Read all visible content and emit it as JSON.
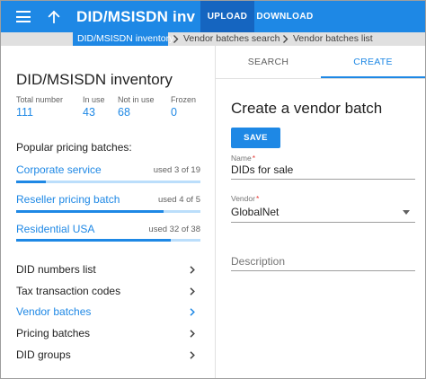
{
  "toolbar": {
    "menu_icon": "menu-icon",
    "back_icon": "arrow-up-icon",
    "title": "DID/MSISDN inventory",
    "upload_label": "UPLOAD",
    "download_label": "DOWNLOAD"
  },
  "breadcrumb": {
    "items": [
      "DID/MSISDN inventory",
      "Vendor batches search",
      "Vendor batches list"
    ]
  },
  "inventory": {
    "title": "DID/MSISDN inventory",
    "stats": [
      {
        "label": "Total number",
        "value": "111"
      },
      {
        "label": "In use",
        "value": "43"
      },
      {
        "label": "Not in use",
        "value": "68"
      },
      {
        "label": "Frozen",
        "value": "0"
      }
    ],
    "popular_label": "Popular pricing batches:",
    "batches": [
      {
        "name": "Corporate service",
        "used": "used 3 of 19",
        "fill_fraction": 0.16
      },
      {
        "name": "Reseller pricing batch",
        "used": "used 4 of 5",
        "fill_fraction": 0.8
      },
      {
        "name": "Residential USA",
        "used": "used 32 of 38",
        "fill_fraction": 0.84
      }
    ],
    "nav": [
      {
        "label": "DID numbers list",
        "active": false
      },
      {
        "label": "Tax transaction codes",
        "active": false
      },
      {
        "label": "Vendor batches",
        "active": true
      },
      {
        "label": "Pricing batches",
        "active": false
      },
      {
        "label": "DID groups",
        "active": false
      }
    ]
  },
  "tabs": {
    "search": "SEARCH",
    "create": "CREATE",
    "active": "create"
  },
  "form": {
    "title": "Create a vendor batch",
    "save_label": "SAVE",
    "name_label": "Name",
    "name_value": "DIDs for sale",
    "vendor_label": "Vendor",
    "vendor_value": "GlobalNet",
    "description_placeholder": "Description",
    "required_mark": "*"
  },
  "colors": {
    "accent": "#1e88e5",
    "toolbar_active": "#1565c0",
    "bar_track": "#bbdefb",
    "required": "#e53935"
  }
}
